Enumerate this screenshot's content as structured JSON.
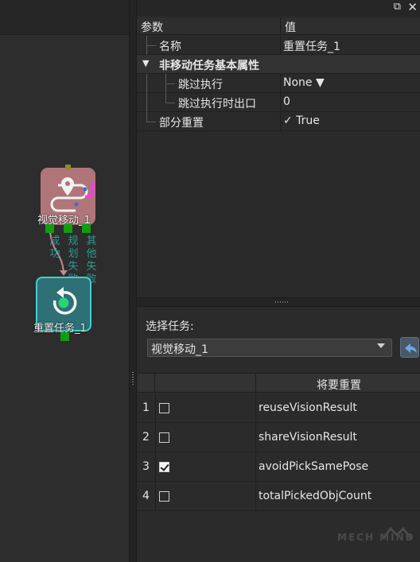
{
  "colors": {
    "accent": "#3fd0d0",
    "move_node": "#b07579",
    "reset_node": "#2f6f76",
    "port": "#119d11",
    "output_label": "#2a9a95",
    "magenta": "#ff33ff"
  },
  "canvas": {
    "move_node": {
      "label": "视觉移动_1",
      "icon": "location-path-icon",
      "outputs": [
        {
          "label": "成功"
        },
        {
          "label": "规划失败"
        },
        {
          "label": "其他失败"
        }
      ]
    },
    "reset_node": {
      "label": "重置任务_1",
      "icon": "reset-icon"
    }
  },
  "property_panel": {
    "header": {
      "param": "参数",
      "value": "值"
    },
    "rows": [
      {
        "key": "名称",
        "value": "重置任务_1"
      },
      {
        "key": "非移动任务基本属性",
        "value": ""
      },
      {
        "key": "跳过执行",
        "value": "None ▼"
      },
      {
        "key": "跳过执行时出口",
        "value": "0"
      },
      {
        "key": "部分重置",
        "value": "✓  True"
      }
    ]
  },
  "reset_panel": {
    "select_label": "选择任务:",
    "selected_task": "视觉移动_1",
    "table_header": "将要重置",
    "rows": [
      {
        "num": "1",
        "checked": false,
        "name": "reuseVisionResult"
      },
      {
        "num": "2",
        "checked": false,
        "name": "shareVisionResult"
      },
      {
        "num": "3",
        "checked": true,
        "name": "avoidPickSamePose"
      },
      {
        "num": "4",
        "checked": false,
        "name": "totalPickedObjCount"
      }
    ]
  },
  "watermark": "MECH MIND"
}
